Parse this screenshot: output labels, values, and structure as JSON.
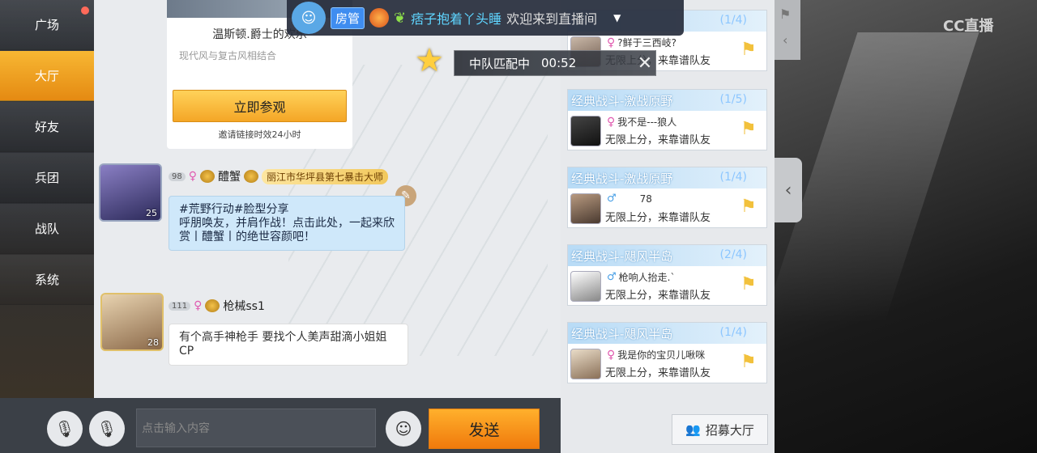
{
  "sidebar": {
    "items": [
      {
        "label": "广场"
      },
      {
        "label": "大厅"
      },
      {
        "label": "好友"
      },
      {
        "label": "兵团"
      },
      {
        "label": "战队"
      },
      {
        "label": "系统"
      }
    ],
    "active_index": 1
  },
  "invite_card": {
    "title": "温斯顿.爵士的欢乐",
    "subtitle": "现代风与复古风相结合",
    "button_label": "立即参观",
    "note": "邀请链接时效24小时"
  },
  "messages": [
    {
      "level": "98",
      "name": "醴蟹",
      "avatar_level": "25",
      "title": "丽江市华坪县第七暴击大师",
      "text": "#荒野行动#脸型分享\n呼朋唤友，并肩作战！点击此处，一起来欣赏丨醴蟹丨的绝世容颜吧！"
    },
    {
      "level": "111",
      "name": "枪械ss1",
      "avatar_level": "28",
      "text": "有个高手神枪手 要找个人美声甜滴小姐姐CP"
    }
  ],
  "input": {
    "placeholder": "点击输入内容",
    "send_label": "发送"
  },
  "banner": {
    "role": "房管",
    "name": "痞子抱着丫头睡",
    "welcome": "欢迎来到直播间",
    "dropdown": "▼"
  },
  "match_toast": {
    "label": "中队匹配中",
    "timer": "00:52"
  },
  "teams": [
    {
      "mode": "",
      "count": "(1/4)",
      "user": "?鲜于三西岐?",
      "desc": "无限上分，来靠谱队友",
      "gender": "female"
    },
    {
      "mode": "经典战斗-激战原野",
      "count": "(1/5)",
      "user": "我不是---狼人",
      "desc": "无限上分，来靠谱队友",
      "gender": "female"
    },
    {
      "mode": "经典战斗-激战原野",
      "count": "(1/4)",
      "user": "78",
      "desc": "无限上分，来靠谱队友",
      "gender": "male"
    },
    {
      "mode": "经典战斗-飓风半岛",
      "count": "(2/4)",
      "user": "枪响人抬走.`",
      "desc": "无限上分，来靠谱队友",
      "gender": "male"
    },
    {
      "mode": "经典战斗-飓风半岛",
      "count": "(1/4)",
      "user": "我是你的宝贝儿啾咪",
      "desc": "无限上分，来靠谱队友",
      "gender": "female"
    }
  ],
  "recruit_button": "招募大厅",
  "watermark": "CC直播",
  "colors": {
    "accent_orange": "#f4a626",
    "bubble_blue": "#cfe8fa",
    "female_pink": "#e05bb0",
    "male_blue": "#4aa0e6"
  }
}
